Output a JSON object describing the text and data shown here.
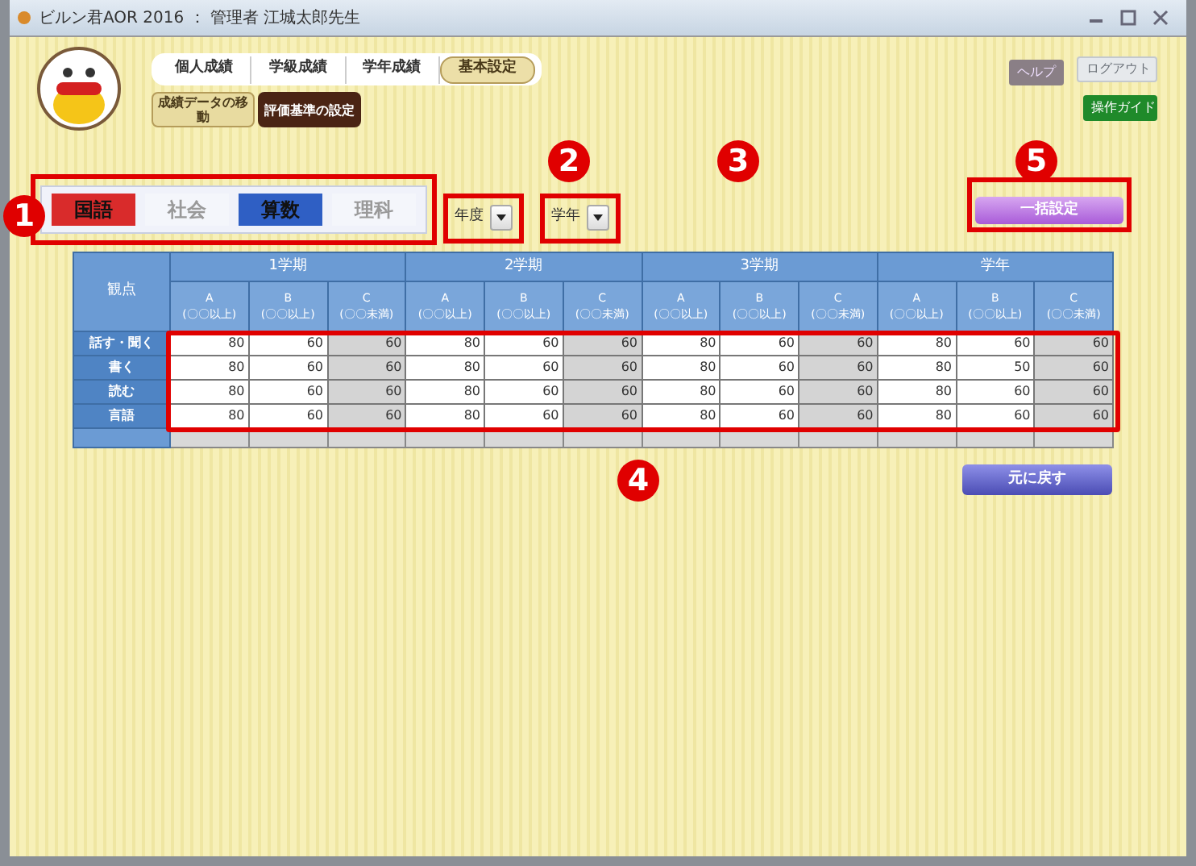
{
  "window": {
    "title": "ビルン君AOR 2016 ： 管理者 江城太郎先生"
  },
  "nav_tabs": [
    {
      "label": "個人成績",
      "selected": false
    },
    {
      "label": "学級成績",
      "selected": false
    },
    {
      "label": "学年成績",
      "selected": false
    },
    {
      "label": "基本設定",
      "selected": true
    }
  ],
  "sub_tabs": [
    {
      "label": "成績データの移動",
      "selected": false
    },
    {
      "label": "評価基準の設定",
      "selected": true
    }
  ],
  "header_buttons": [
    {
      "kind": "help",
      "label": "ヘルプ"
    },
    {
      "kind": "logout",
      "label": "ログアウト"
    },
    {
      "kind": "guide",
      "label": "操作ガイド"
    }
  ],
  "subjects": [
    {
      "label": "国語",
      "color": "#d92b2b"
    },
    {
      "label": "社会",
      "color": "#f4f6fb"
    },
    {
      "label": "算数",
      "color": "#2f5fc4"
    },
    {
      "label": "理科",
      "color": "#f4f6fb"
    }
  ],
  "filters": [
    {
      "label": "年度"
    },
    {
      "label": "学年"
    }
  ],
  "bulk_button": "一括設定",
  "table": {
    "corner": "観点",
    "terms": [
      {
        "label": "1学期",
        "columns": [
          {
            "grade": "A",
            "note": "(〇〇以上)",
            "editable": true
          },
          {
            "grade": "B",
            "note": "(〇〇以上)",
            "editable": true
          },
          {
            "grade": "C",
            "note": "(〇〇未満)",
            "editable": false
          }
        ]
      },
      {
        "label": "2学期",
        "columns": [
          {
            "grade": "A",
            "note": "(〇〇以上)",
            "editable": true
          },
          {
            "grade": "B",
            "note": "(〇〇以上)",
            "editable": true
          },
          {
            "grade": "C",
            "note": "(〇〇未満)",
            "editable": false
          }
        ]
      },
      {
        "label": "3学期",
        "columns": [
          {
            "grade": "A",
            "note": "(〇〇以上)",
            "editable": true
          },
          {
            "grade": "B",
            "note": "(〇〇以上)",
            "editable": true
          },
          {
            "grade": "C",
            "note": "(〇〇未満)",
            "editable": false
          }
        ]
      },
      {
        "label": "学年",
        "columns": [
          {
            "grade": "A",
            "note": "(〇〇以上)",
            "editable": true
          },
          {
            "grade": "B",
            "note": "(〇〇以上)",
            "editable": true
          },
          {
            "grade": "C",
            "note": "(〇〇未満)",
            "editable": false
          }
        ]
      }
    ],
    "rows": [
      {
        "label": "話す・聞く",
        "values": [
          "80",
          "60",
          "60",
          "80",
          "60",
          "60",
          "80",
          "60",
          "60",
          "80",
          "60",
          "60"
        ]
      },
      {
        "label": "書く",
        "values": [
          "80",
          "60",
          "60",
          "80",
          "60",
          "60",
          "80",
          "60",
          "60",
          "80",
          "50",
          "60"
        ]
      },
      {
        "label": "読む",
        "values": [
          "80",
          "60",
          "60",
          "80",
          "60",
          "60",
          "80",
          "60",
          "60",
          "80",
          "60",
          "60"
        ]
      },
      {
        "label": "言語",
        "values": [
          "80",
          "60",
          "60",
          "80",
          "60",
          "60",
          "80",
          "60",
          "60",
          "80",
          "60",
          "60"
        ]
      }
    ]
  },
  "reset_button": "元に戻す",
  "annotations": [
    {
      "number": "1"
    },
    {
      "number": "2"
    },
    {
      "number": "3"
    },
    {
      "number": "4"
    },
    {
      "number": "5"
    }
  ]
}
